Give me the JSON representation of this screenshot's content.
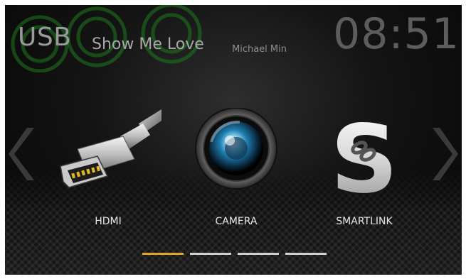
{
  "now_playing": {
    "source": "USB",
    "song": "Show Me Love",
    "artist": "Michael Min"
  },
  "clock": "08:51",
  "apps": [
    {
      "label": "HDMI",
      "icon": "hdmi-plug-icon"
    },
    {
      "label": "CAMERA",
      "icon": "camera-lens-icon"
    },
    {
      "label": "SMARTLINK",
      "icon": "smartlink-s-icon"
    }
  ],
  "pager": {
    "pages": 4,
    "active_index": 0
  },
  "colors": {
    "accent": "#e2a222",
    "background": "#0a0a0a",
    "label": "#e6e6e6"
  }
}
